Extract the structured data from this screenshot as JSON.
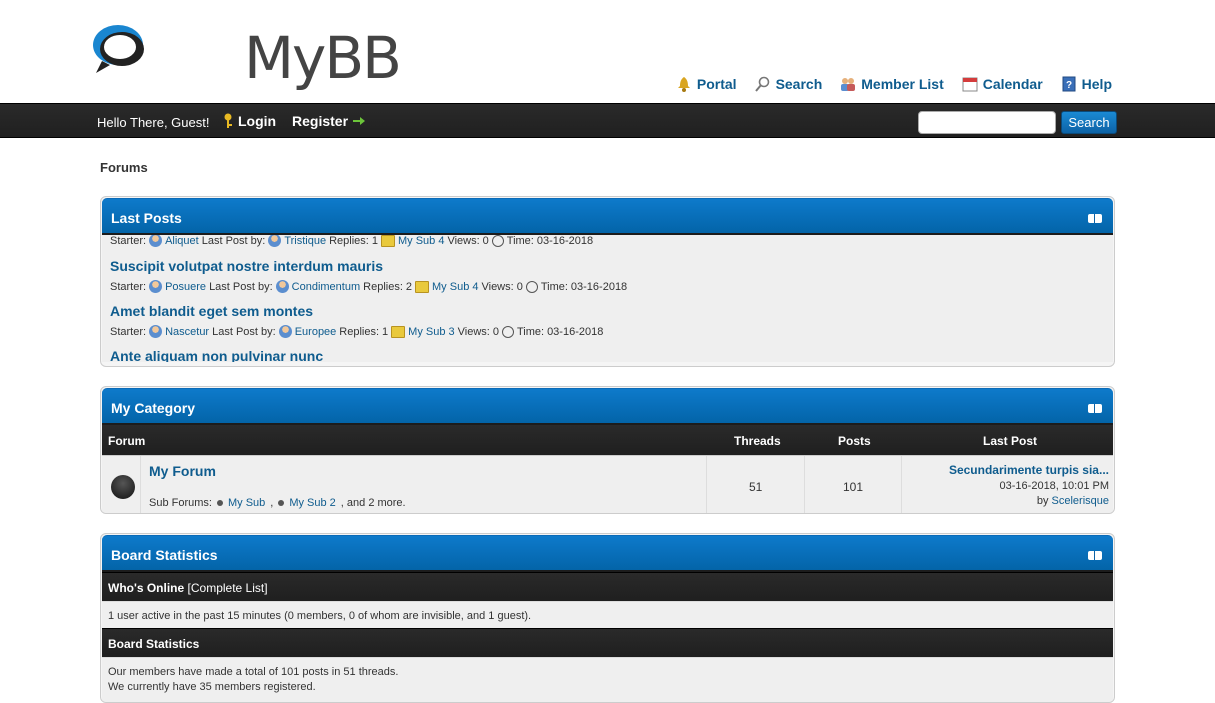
{
  "brand": {
    "logo_text": "MyBB"
  },
  "toplinks": [
    {
      "label": "Portal",
      "icon": "portal-icon"
    },
    {
      "label": "Search",
      "icon": "search-icon"
    },
    {
      "label": "Member List",
      "icon": "members-icon"
    },
    {
      "label": "Calendar",
      "icon": "calendar-icon"
    },
    {
      "label": "Help",
      "icon": "help-icon"
    }
  ],
  "panel": {
    "welcome": "Hello There, Guest!",
    "login": "Login",
    "register": "Register",
    "search_button": "Search",
    "search_value": ""
  },
  "breadcrumb": "Forums",
  "last_posts": {
    "title": "Last Posts",
    "items": [
      {
        "title": "",
        "starter": "Aliquet",
        "last_by": "Tristique",
        "replies": "1",
        "forum": "My Sub 4",
        "views": "0",
        "time": "03-16-2018"
      },
      {
        "title": "Suscipit volutpat nostre interdum mauris",
        "starter": "Posuere",
        "last_by": "Condimentum",
        "replies": "2",
        "forum": "My Sub 4",
        "views": "0",
        "time": "03-16-2018"
      },
      {
        "title": "Amet blandit eget sem montes",
        "starter": "Nascetur",
        "last_by": "Europee",
        "replies": "1",
        "forum": "My Sub 3",
        "views": "0",
        "time": "03-16-2018"
      },
      {
        "title": "Ante aliquam non pulvinar nunc"
      }
    ],
    "labels": {
      "starter": "Starter:",
      "last_by": "Last Post by:",
      "replies": "Replies:",
      "views": "Views:",
      "time": "Time:"
    }
  },
  "category": {
    "title": "My Category",
    "columns": {
      "forum": "Forum",
      "threads": "Threads",
      "posts": "Posts",
      "last_post": "Last Post"
    },
    "forum": {
      "name": "My Forum",
      "subforums_label": "Sub Forums:",
      "sub1": "My Sub",
      "sub2": "My Sub 2",
      "more": ", and 2 more.",
      "threads": "51",
      "posts": "101",
      "last_title": "Secundarimente turpis sia...",
      "last_date": "03-16-2018, 10:01 PM",
      "last_by_label": "by",
      "last_by": "Scelerisque"
    }
  },
  "stats": {
    "title": "Board Statistics",
    "online_header": "Who's Online",
    "online_link": "[Complete List]",
    "online_text": "1 user active in the past 15 minutes (0 members, 0 of whom are invisible, and 1 guest).",
    "stats_header": "Board Statistics",
    "line1": "Our members have made a total of 101 posts in 51 threads.",
    "line2": "We currently have 35 members registered."
  }
}
